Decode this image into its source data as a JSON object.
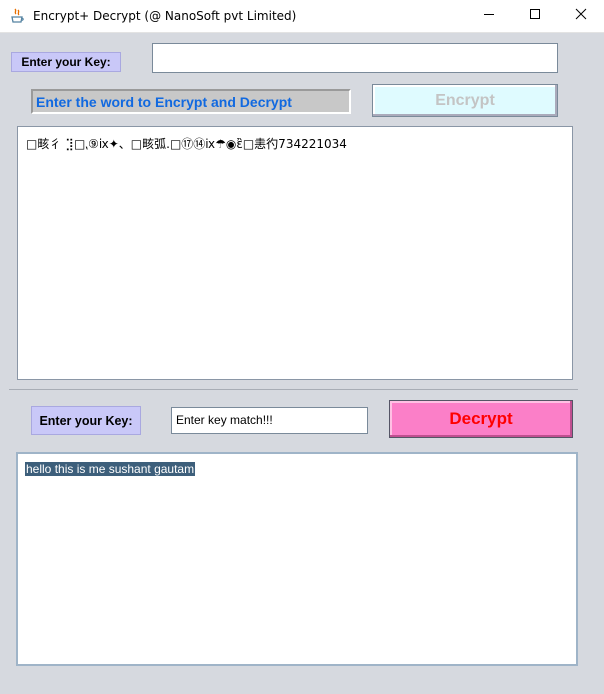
{
  "window": {
    "title": "Encrypt+ Decrypt (@ NanoSoft pvt Limited)",
    "controls": [
      "minimize-icon",
      "maximize-icon",
      "close-icon"
    ]
  },
  "encrypt_section": {
    "key_label": "Enter your Key:",
    "key_value": "",
    "word_label": "Enter the word to Encrypt and Decrypt",
    "encrypt_button": "Encrypt",
    "encrypted_text": "□畡彳 ⣹□⹁⑨ⅸ✦、□畡弧.□⑰⑭ⅸ☂◉ἒ□恚彴734221034"
  },
  "decrypt_section": {
    "key_label": "Enter your Key:",
    "key_value": "Enter key match!!!",
    "decrypt_button": "Decrypt",
    "decrypted_text": "hello this is me sushant gautam"
  },
  "colors": {
    "background": "#d6d9df",
    "key_label_bg": "#c9c8f8",
    "word_label_text": "#1169e0",
    "encrypt_button_bg": "#dffbff",
    "decrypt_button_bg": "#fb7fc8",
    "decrypt_button_text": "#ff0000",
    "selection_bg": "#3d5f7b"
  }
}
